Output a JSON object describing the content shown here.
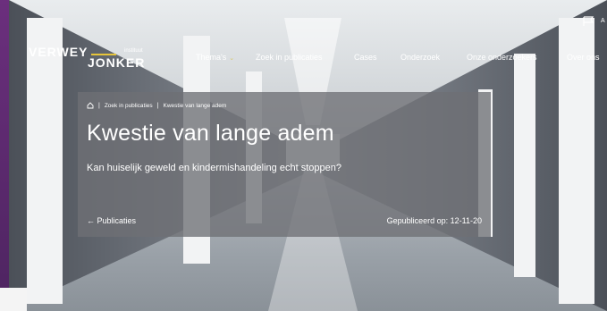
{
  "header": {
    "logo": {
      "line1": "VERWEY",
      "small": "instituut",
      "line2": "JONKER"
    },
    "language": "A",
    "nav": [
      {
        "label": "Thema's",
        "has_dropdown": true
      },
      {
        "label": "Zoek in publicaties",
        "has_dropdown": false
      },
      {
        "label": "Cases",
        "has_dropdown": false
      },
      {
        "label": "Onderzoek",
        "has_dropdown": false
      },
      {
        "label": "Onze onderzoekers",
        "has_dropdown": false
      },
      {
        "label": "Over ons",
        "has_dropdown": false
      }
    ],
    "nav_chevron": "⌄"
  },
  "breadcrumb": {
    "items": [
      "Zoek in publicaties",
      "Kwestie van lange adem"
    ],
    "separator": "|"
  },
  "hero": {
    "title": "Kwestie van lange adem",
    "subtitle": "Kan huiselijk geweld en kindermishandeling echt stoppen?",
    "back_arrow": "←",
    "back_label": "Publicaties",
    "published": "Gepubliceerd op: 12-11-20"
  },
  "colors": {
    "brand_purple": "#5a2a6e",
    "logo_accent": "#e7c53a",
    "panel": "#6e7074"
  }
}
